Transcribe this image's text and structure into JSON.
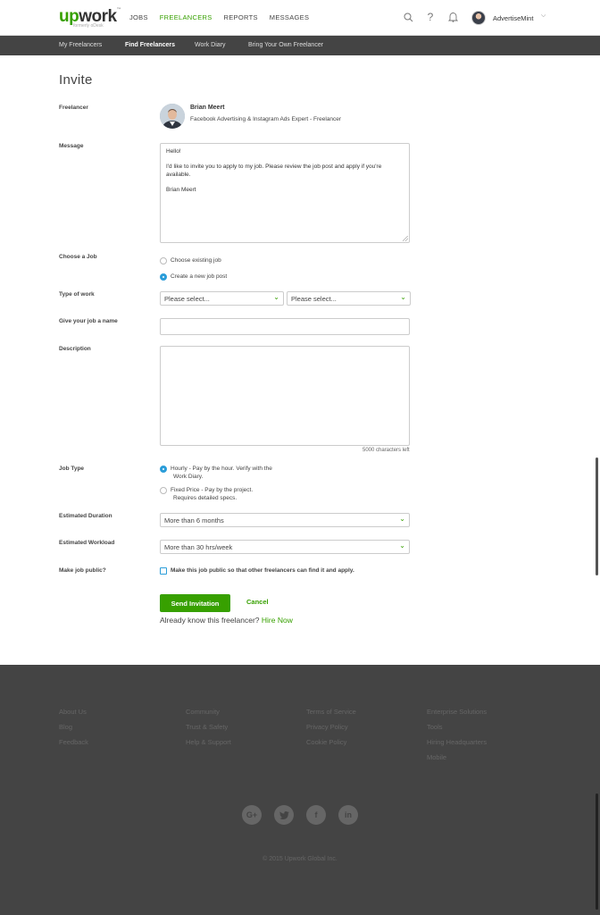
{
  "topnav": {
    "logo_up": "up",
    "logo_work": "work",
    "logo_sub": "formerly oDesk",
    "links": [
      "JOBS",
      "FREELANCERS",
      "REPORTS",
      "MESSAGES"
    ],
    "active": "FREELANCERS",
    "icons": [
      "search-icon",
      "help-icon",
      "bell-icon"
    ],
    "user": "AdvertiseMint"
  },
  "subnav": {
    "items": [
      "My Freelancers",
      "Find Freelancers",
      "Work Diary",
      "Bring Your Own Freelancer"
    ],
    "active": "Find Freelancers"
  },
  "page": {
    "title": "Invite",
    "labels": {
      "freelancer": "Freelancer",
      "message": "Message",
      "choose_job": "Choose a Job",
      "type_of_work": "Type of work",
      "job_name": "Give your job a name",
      "description": "Description",
      "job_type": "Job Type",
      "duration": "Estimated Duration",
      "workload": "Estimated Workload",
      "public": "Make job public?"
    },
    "freelancer": {
      "name": "Brian Meert",
      "title": "Facebook Advertising & Instagram Ads Expert - Freelancer"
    },
    "message": "Hello!\n\nI'd like to invite you to apply to my job. Please review the job post and apply if you're available.\n\nBrian Meert",
    "choose_job": {
      "existing": "Choose existing job",
      "new": "Create a new job post",
      "selected": "new"
    },
    "type_of_work": {
      "category": "Please select...",
      "subcategory": "Please select..."
    },
    "job_name_value": "",
    "description_value": "",
    "chars_left": "5000 characters left",
    "job_type": {
      "hourly_line1": "Hourly - Pay by the hour. Verify with the",
      "hourly_line2": "Work Diary.",
      "fixed_line1": "Fixed Price - Pay by the project.",
      "fixed_line2": "Requires detailed specs.",
      "selected": "hourly"
    },
    "duration": "More than 6 months",
    "workload": "More than 30 hrs/week",
    "public_text": "Make this job public so that other freelancers can find it and apply.",
    "public_checked": false,
    "send_label": "Send Invitation",
    "cancel_label": "Cancel",
    "know_text": "Already know this freelancer?",
    "hire_now": "Hire Now"
  },
  "footer": {
    "col1": [
      "About Us",
      "Blog",
      "Feedback"
    ],
    "col2": [
      "Community",
      "Trust & Safety",
      "Help & Support"
    ],
    "col3": [
      "Terms of Service",
      "Privacy Policy",
      "Cookie Policy"
    ],
    "col4": [
      "Enterprise Solutions",
      "Tools",
      "Hiring Headquarters",
      "Mobile"
    ],
    "social": [
      "google-plus-icon",
      "twitter-icon",
      "facebook-icon",
      "linkedin-icon"
    ],
    "copyright": "© 2015 Upwork Global Inc."
  },
  "colors": {
    "brand_green": "#37a000",
    "accent_blue": "#2b9dd9",
    "subnav_bg": "#444444",
    "footer_bg": "#444444"
  }
}
